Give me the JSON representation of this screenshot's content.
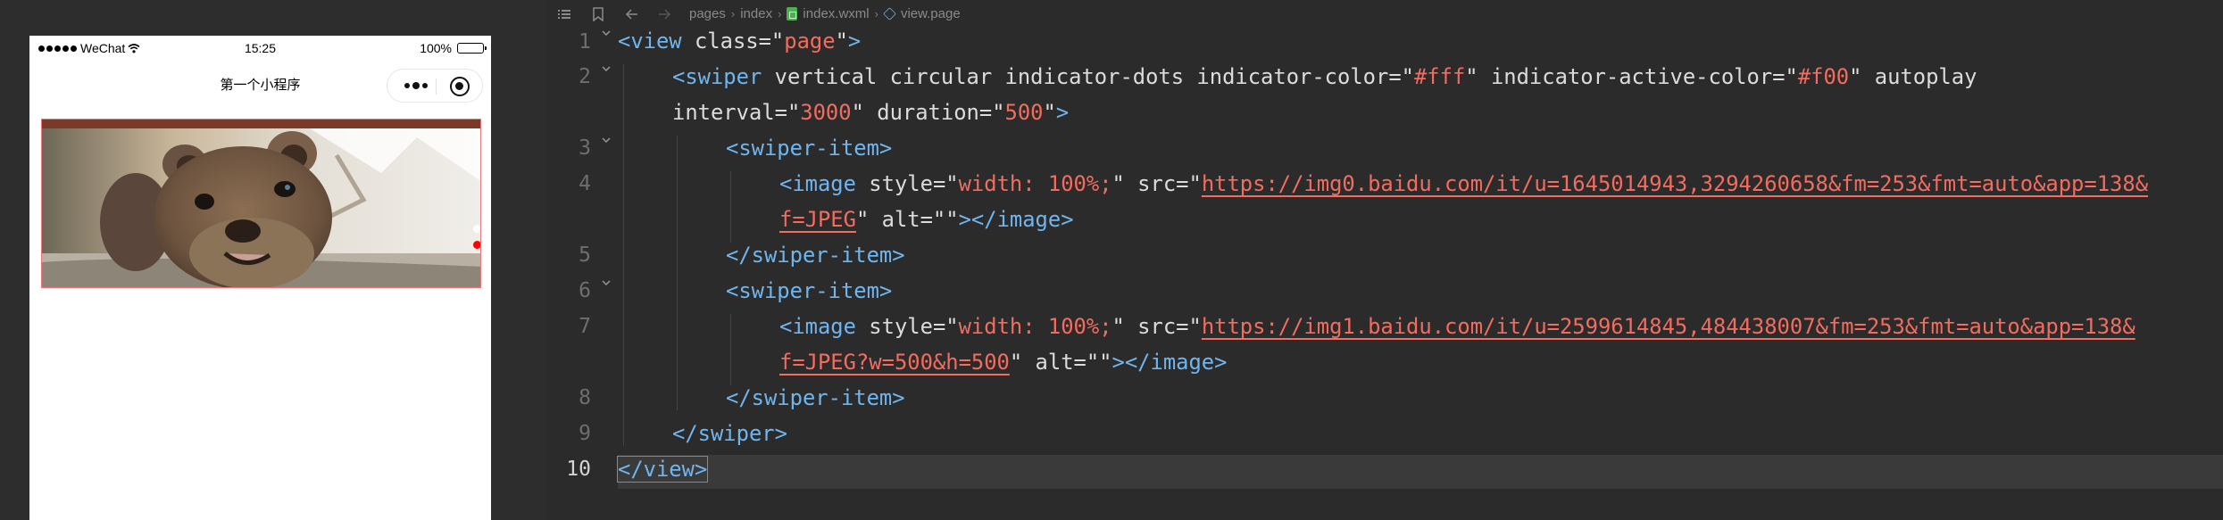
{
  "simulator": {
    "status_bar": {
      "carrier": "WeChat",
      "time": "15:25",
      "battery_percent": "100%",
      "battery_level": 1.0
    },
    "nav_bar": {
      "title": "第一个小程序"
    },
    "swiper": {
      "slide_count": 2,
      "active_slide_index": 0,
      "indicator_color": "#ffffff",
      "indicator_active_color": "#ff0000"
    }
  },
  "editor": {
    "breadcrumb": [
      {
        "label": "pages",
        "icon": "none"
      },
      {
        "label": "index",
        "icon": "none"
      },
      {
        "label": "index.wxml",
        "icon": "wxml-file-icon"
      },
      {
        "label": "view.page",
        "icon": "cube-icon"
      }
    ],
    "line_numbers": [
      "1",
      "2",
      "3",
      "4",
      "5",
      "6",
      "7",
      "8",
      "9",
      "10"
    ],
    "active_line": "10",
    "code": {
      "l1": [
        "<view",
        " class",
        "=\"",
        "page",
        "\"",
        ">"
      ],
      "l2a": [
        "<swiper",
        " vertical circular indicator-dots indicator-color",
        "=\"",
        "#fff",
        "\"",
        " indicator-active-color",
        "=\"",
        "#f00",
        "\"",
        " autoplay"
      ],
      "l2b": [
        "interval",
        "=\"",
        "3000",
        "\"",
        " duration",
        "=\"",
        "500",
        "\"",
        ">"
      ],
      "l3": [
        "<swiper-item>"
      ],
      "l4a": [
        "<image",
        " style",
        "=\"",
        "width: 100%;",
        "\"",
        " src",
        "=\"",
        "https://img0.baidu.com/it/u=1645014943,3294260658&fm=253&fmt=auto&app=138&"
      ],
      "l4b": [
        "f=JPEG",
        "\"",
        " alt",
        "=\"\"",
        "></image>"
      ],
      "l5": [
        "</swiper-item>"
      ],
      "l6": [
        "<swiper-item>"
      ],
      "l7a": [
        "<image",
        " style",
        "=\"",
        "width: 100%;",
        "\"",
        " src",
        "=\"",
        "https://img1.baidu.com/it/u=2599614845,484438007&fm=253&fmt=auto&app=138&"
      ],
      "l7b": [
        "f=JPEG?w=500&h=500",
        "\"",
        " alt",
        "=\"\"",
        "></image>"
      ],
      "l8": [
        "</swiper-item>"
      ],
      "l9": [
        "</swiper>"
      ],
      "l10": [
        "</view>"
      ]
    }
  },
  "colors": {
    "tag": "#6fb5f0",
    "string": "#f26c5f",
    "attribute": "#dcdcdc",
    "editor_bg": "#2b2b2b",
    "current_line": "#3a3a3a"
  }
}
